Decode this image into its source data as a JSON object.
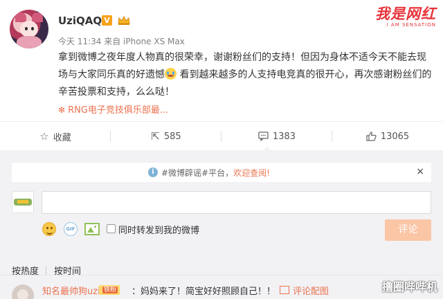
{
  "post": {
    "username": "UziQAQ",
    "verified_badge": "V",
    "meta_time": "今天 11:34",
    "meta_from": "来自 iPhone XS Max",
    "content_before_emoji": "拿到微博之夜年度人物真的很荣幸，谢谢粉丝们的支持！但因为身体不适今天不能去现场与大家同乐真的好遗憾",
    "content_after_emoji": "看到越来越多的人支持电竞真的很开心，再次感谢粉丝们的辛苦投票和支持，么么哒！",
    "source_tag": "RNG电子竞技俱乐部最...",
    "watermark_big": "我是网红",
    "watermark_small": "I AM SENSATION",
    "icons": [
      "crown-icon",
      "cry-emoji-icon",
      "flower-icon"
    ]
  },
  "actions": {
    "favorite": {
      "label": "收藏",
      "icon": "star-icon"
    },
    "repost": {
      "label": "585",
      "icon": "share-icon"
    },
    "comment": {
      "label": "1383",
      "icon": "comment-icon"
    },
    "like": {
      "label": "13065",
      "icon": "thumbs-up-icon"
    }
  },
  "comment_area": {
    "notice_prefix": "#微博辟谣#平台，",
    "notice_link": "欢迎查阅!",
    "notice_close": "×",
    "input_placeholder": "",
    "repost_checkbox_label": "同时转发到我的微博",
    "submit_label": "评论",
    "sort_hot": "按热度",
    "sort_time": "按时间"
  },
  "comments": [
    {
      "user": "知名最帅狗uzi",
      "badge_level": "",
      "badge_text": "铁粉",
      "text": "：妈妈来了！简宝好好照顾自己！！",
      "pic_label": "评论配图"
    }
  ],
  "bottom_watermark": "撸圈哔哔机",
  "colors": {
    "link": "#eb7350",
    "submit_disabled": "#fbc6a6",
    "comment_bg": "#f2f2f5"
  }
}
